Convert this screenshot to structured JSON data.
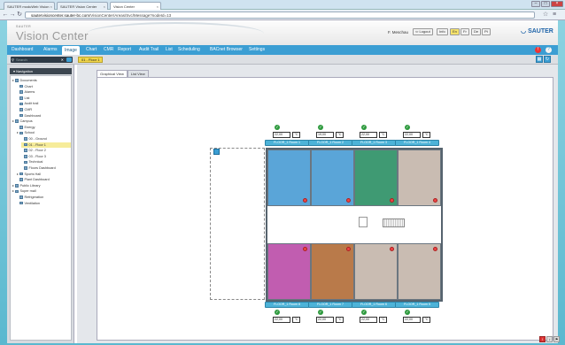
{
  "browser": {
    "tabs": [
      {
        "label": "SAUTER moduWeb Vision"
      },
      {
        "label": "SAUTER Vision Center"
      },
      {
        "label": "Vision Center"
      }
    ],
    "url_host": "sautervisioncenter.sauter-bc.com",
    "url_path": "/VisionCenter/Areas/Svc/Message?nodeId=13"
  },
  "header": {
    "brand_small": "SAUTER",
    "app_title": "Vision Center",
    "user": "F. Meschau",
    "logout": "Logout",
    "info": "Info",
    "languages": [
      "En",
      "Fr",
      "De",
      "Pt"
    ],
    "company": "SAUTER"
  },
  "nav": {
    "items": [
      "Dashboard",
      "Alarms",
      "Image",
      "Chart",
      "CMR",
      "Report",
      "Audit Trail",
      "List",
      "Scheduling",
      "BACnet Browser",
      "Settings"
    ],
    "active": "Image"
  },
  "search": {
    "placeholder": "Search"
  },
  "breadcrumb": "01 - Floor 1",
  "sidebar": {
    "title": "Navigation",
    "tree": [
      {
        "label": "Documents",
        "level": 0
      },
      {
        "label": "Chart",
        "level": 1
      },
      {
        "label": "Alarms",
        "level": 1
      },
      {
        "label": "List",
        "level": 1
      },
      {
        "label": "Audit trail",
        "level": 1
      },
      {
        "label": "CMR",
        "level": 1
      },
      {
        "label": "Dashboard",
        "level": 1
      },
      {
        "label": "Campus",
        "level": 0
      },
      {
        "label": "Energy",
        "level": 1
      },
      {
        "label": "School",
        "level": 1
      },
      {
        "label": "00 - Ground",
        "level": 2
      },
      {
        "label": "01 - Floor 1",
        "level": 2,
        "selected": true
      },
      {
        "label": "02 - Floor 2",
        "level": 2
      },
      {
        "label": "03 - Floor 3",
        "level": 2
      },
      {
        "label": "Technical",
        "level": 2
      },
      {
        "label": "Floors Dashboard",
        "level": 2
      },
      {
        "label": "Sports Hall",
        "level": 1
      },
      {
        "label": "Plant Dashboard",
        "level": 1
      },
      {
        "label": "Public Library",
        "level": 0
      },
      {
        "label": "Super mall",
        "level": 0
      },
      {
        "label": "Refrigeration",
        "level": 1
      },
      {
        "label": "Ventilation",
        "level": 1
      }
    ]
  },
  "content_tabs": [
    "Graphical View",
    "List View"
  ],
  "active_content_tab": "Graphical View",
  "rooms_top": [
    {
      "label": "FLOOR_1 Room 1",
      "value": "22,00",
      "unit": "°C",
      "color": "#5aa5d8"
    },
    {
      "label": "FLOOR_1 Room 2",
      "value": "19,00",
      "unit": "°C",
      "color": "#5aa5d8"
    },
    {
      "label": "FLOOR_1 Room 3",
      "value": "22,00",
      "unit": "°C",
      "color": "#3f9a73"
    },
    {
      "label": "FLOOR_1 Room 4",
      "value": "22,00",
      "unit": "°C",
      "color": "#c9bcb2"
    }
  ],
  "rooms_bottom": [
    {
      "label": "FLOOR_1 Room 8",
      "value": "22,00",
      "unit": "°C",
      "color": "#c15db0"
    },
    {
      "label": "FLOOR_1 Room 7",
      "value": "22,00",
      "unit": "°C",
      "color": "#b97a4a"
    },
    {
      "label": "FLOOR_1 Room 6",
      "value": "22,00",
      "unit": "°C",
      "color": "#c9bcb2"
    },
    {
      "label": "FLOOR_1 Room 5",
      "value": "22,00",
      "unit": "°C",
      "color": "#c9bcb2"
    }
  ]
}
